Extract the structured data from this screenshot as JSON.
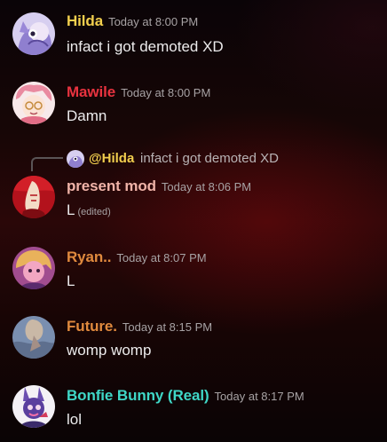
{
  "messages": [
    {
      "author": "Hilda",
      "author_color": "#f2cf4e",
      "timestamp": "Today at 8:00 PM",
      "text": "infact i got demoted XD"
    },
    {
      "author": "Mawile",
      "author_color": "#e8333f",
      "timestamp": "Today at 8:00 PM",
      "text": "Damn"
    },
    {
      "author": "present mod",
      "author_color": "#f0b3a8",
      "timestamp": "Today at 8:06 PM",
      "text": "L",
      "edited_label": "(edited)",
      "reply": {
        "mention": "@Hilda",
        "text": "infact i got demoted XD"
      }
    },
    {
      "author": "Ryan..",
      "author_color": "#e08a3e",
      "timestamp": "Today at 8:07 PM",
      "text": "L"
    },
    {
      "author": "Future.",
      "author_color": "#e08a3e",
      "timestamp": "Today at 8:15 PM",
      "text": "womp womp"
    },
    {
      "author": "Bonfie Bunny (Real)",
      "author_color": "#3fd7c7",
      "timestamp": "Today at 8:17 PM",
      "text": "lol"
    }
  ]
}
